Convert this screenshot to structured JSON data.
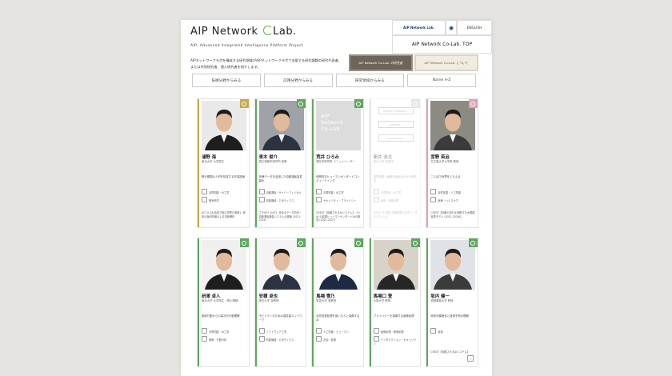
{
  "header": {
    "logo_text": "AIP Network",
    "logo_text_2": "Lab.",
    "tagline": "AIP: Advanced Integrated Intelligence Platform Project",
    "aip_mini": "AIP Network Lab.",
    "globe_icon": "globe-icon",
    "lang": "ENGLISH",
    "top_link": "AIP Network Co-Lab.  TOP"
  },
  "intro": "AIPネットワークラボを構成する研究領域がAIPネットワークラボで支援する研究課題の研究代表者、または共同研究者、個人研究者を紹介します。",
  "buttons": {
    "primary": "AIP Network Co-Lab. の研究者",
    "secondary": "AIP Network Co-Lab. について"
  },
  "tabs": [
    "技術分野からみる",
    "応用分野からみる",
    "研究領域からみる",
    "Name A-Z"
  ],
  "colors": {
    "gold": "#c9a94a",
    "green": "#5fa760",
    "grey": "#bbbbbb",
    "pink": "#e3a1b6",
    "brown": "#6e6558"
  },
  "row1": [
    {
      "name": "浦野 海",
      "aff": "東京大学 大学院生",
      "theme": "移行期間の人材を特定する先端技術",
      "tags": [
        "計算知能・AI工学",
        "暗号科学"
      ],
      "proj": "ACT-X【AI活用で挑む学問の革新】 物体の幾何情報のよる流体解析",
      "accent": "gold"
    },
    {
      "name": "青木 俊介",
      "aff": "国立情報学研究所 助教",
      "theme": "多様データを活用した自動運転高性能化",
      "tags": [
        "自動運転・サイバーフィジカル",
        "知能機械・ロボティクス"
      ],
      "proj": "さきがけ【IoT】 安全なデータ共有・自動運転基盤システムの構築 (2021-2024)",
      "accent": "green"
    },
    {
      "name": "荒井 ひろみ",
      "aff": "理化学研究所 ユニットリーダー",
      "theme": "個別的なヒューマンセンタードコンピューティング",
      "tags": [
        "計算知能・AI工学",
        "セキュリティ・プライバシー"
      ],
      "proj": "CREST【信頼されるAIシステム】 人と AI の協調ヒューマンセンタードAIの実現 (2021-2027)",
      "accent": "green",
      "kind": "logo"
    },
    {
      "name": "新井 圭太",
      "aff": "東京大学 准教授",
      "theme": "自然言語と画像を組み合わせた新手法",
      "tags": [
        "計算知能・AI工学",
        "画像・映像処理"
      ],
      "proj": "CREST【人間と情報環境の共生インタラクション】",
      "accent": "grey",
      "kind": "project",
      "faded": true
    },
    {
      "name": "宮野 英治",
      "aff": "名古屋大学大学院 教授",
      "theme": "ことばで世界をとらえる",
      "tags": [
        "自然言語・人工知能",
        "医療・ヘルスケア"
      ],
      "proj": "CREST【情報の流れを制御する大規模言語モデル (2021-2026)】",
      "accent": "pink"
    }
  ],
  "row2": [
    {
      "name": "研澤 卓人",
      "aff": "東京大学 大学院生（博士課程）",
      "theme": "施設行動からの高次元行動理解",
      "tags": [
        "計算知能・AI工学",
        "映像・行動分析"
      ],
      "proj": "",
      "accent": "green"
    },
    {
      "name": "安積 卓也",
      "aff": "埼玉大学 准教授",
      "theme": "モビリティのための高性能ネットワーク",
      "tags": [
        "ソフトウェア工学",
        "知能機械・ロボティクス"
      ],
      "proj": "",
      "accent": "green"
    },
    {
      "name": "馬場 雪乃",
      "aff": "筑波大学 准教授",
      "theme": "自然言語処理を用いた人と協働するAI",
      "tags": [
        "人工知能・ヒューマン",
        "社会・経済"
      ],
      "proj": "",
      "accent": "green"
    },
    {
      "name": "馬場口 登",
      "aff": "大阪大学 教授",
      "theme": "プライバシーを保護する画像処理",
      "tags": [
        "画像処理・映像処理",
        "インタラクション・セキュリティ"
      ],
      "proj": "",
      "accent": "green"
    },
    {
      "name": "坂内 健一",
      "aff": "慶應義塾大学 教授",
      "theme": "時系列構造化と経済予測の理解",
      "tags": [
        "経済"
      ],
      "proj": "CREST【信頼されるAIシステム】",
      "accent": "green"
    }
  ]
}
